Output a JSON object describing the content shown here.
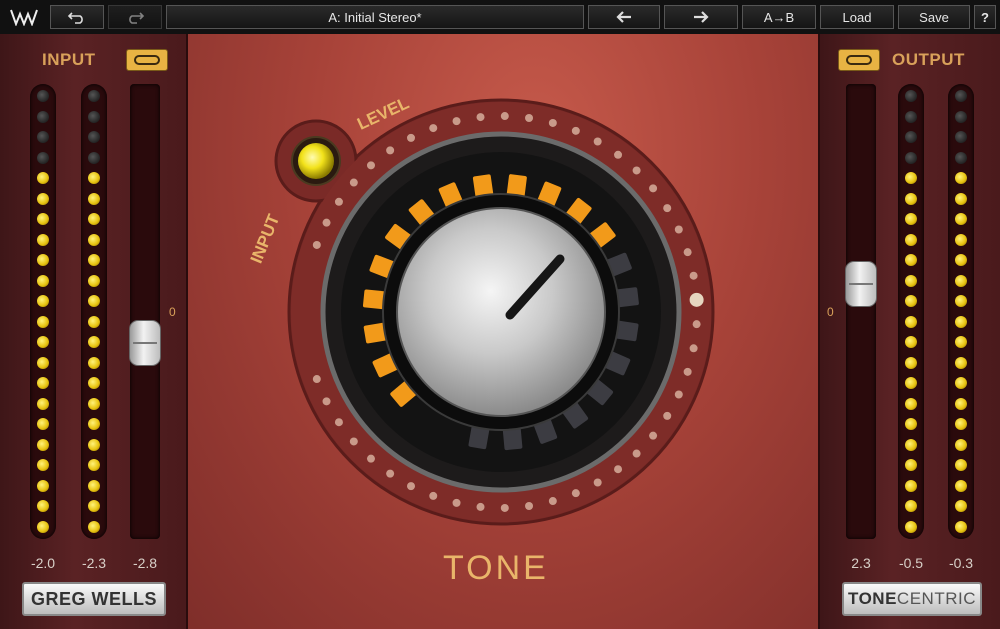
{
  "toolbar": {
    "logo_icon": "waves-logo-icon",
    "undo_icon": "undo-icon",
    "redo_icon": "redo-icon",
    "preset_name": "A: Initial Stereo*",
    "prev_icon": "arrow-left-icon",
    "next_icon": "arrow-right-icon",
    "ab_label": "A→B",
    "load_label": "Load",
    "save_label": "Save",
    "help_label": "?"
  },
  "input": {
    "title": "INPUT",
    "link_icon": "link-icon",
    "fader_zero": "0",
    "meter_left_lit": 18,
    "meter_right_lit": 18,
    "meter_total": 22,
    "fader_level": 0.0,
    "readouts": [
      "-2.0",
      "-2.3",
      "-2.8"
    ],
    "brand": "GREG WELLS"
  },
  "output": {
    "title": "OUTPUT",
    "link_icon": "link-icon",
    "fader_zero": "0",
    "meter_left_lit": 18,
    "meter_right_lit": 18,
    "meter_total": 22,
    "readouts": [
      "2.3",
      "-0.5",
      "-0.3"
    ],
    "brand_part1": "TONE",
    "brand_part2": "CENTRIC"
  },
  "center": {
    "level_label": "LEVEL",
    "input_label": "INPUT",
    "tone_label": "TONE",
    "tone_segments_lit": 13,
    "tone_segments_total": 22,
    "input_led_color": "#f2e21a"
  },
  "colors": {
    "accent": "#e9b56a",
    "segment_on": "#f29a1a",
    "led_on": "#e8c411"
  }
}
